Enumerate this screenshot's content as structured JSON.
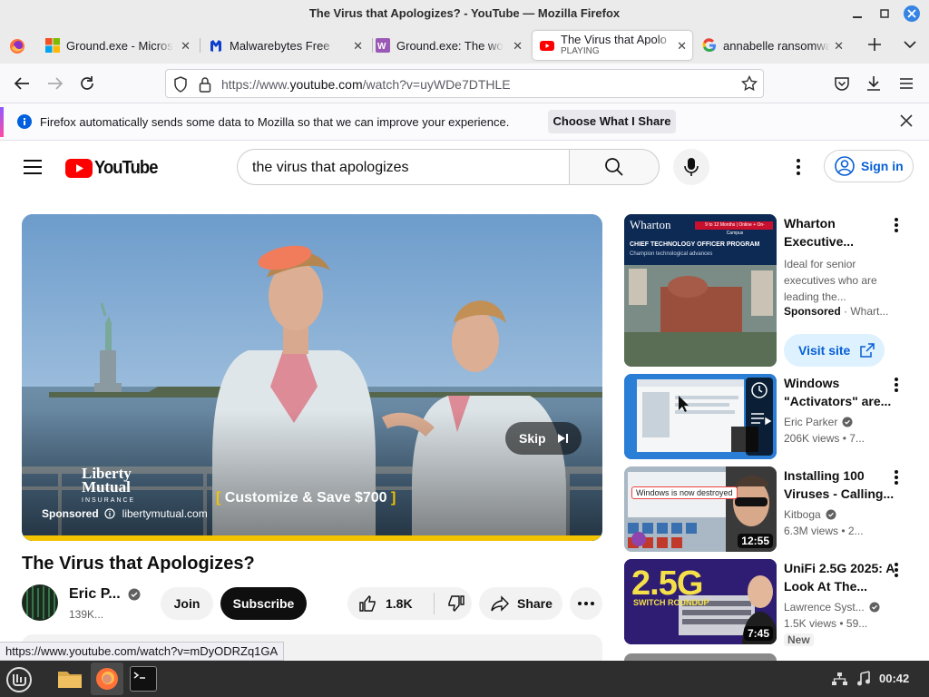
{
  "window": {
    "title": "The Virus that Apologizes? - YouTube — Mozilla Firefox"
  },
  "tabs": [
    {
      "label": "Ground.exe - Micros",
      "icon": "microsoft-logo-icon"
    },
    {
      "label": "Malwarebytes Free",
      "icon": "malwarebytes-icon"
    },
    {
      "label": "Ground.exe: The wo",
      "icon": "wiki-icon"
    },
    {
      "label": "The Virus that Apolo",
      "sub": "PLAYING",
      "icon": "youtube-icon",
      "active": true
    },
    {
      "label": "annabelle ransomwa",
      "icon": "google-icon"
    }
  ],
  "urlbar": {
    "prefix": "https://www.",
    "domain": "youtube.com",
    "path": "/watch?v=uyWDe7DTHLE"
  },
  "notification": {
    "text": "Firefox automatically sends some data to Mozilla so that we can improve your experience.",
    "button": "Choose What I Share"
  },
  "youtube": {
    "logo": "YouTube",
    "search_value": "the virus that apologizes",
    "signin": "Sign in"
  },
  "player": {
    "skip": "Skip",
    "sponsored": "Sponsored",
    "advertiser_url": "libertymutual.com",
    "ad_tagline": "Customize & Save $700",
    "brand_line1": "Liberty",
    "brand_line2": "Mutual",
    "brand_line3": "INSURANCE"
  },
  "video": {
    "title": "The Virus that Apologizes?",
    "channel": "Eric P...",
    "subscribers": "139K...",
    "join": "Join",
    "subscribe": "Subscribe",
    "likes": "1.8K",
    "share": "Share"
  },
  "sidebar": [
    {
      "title": "Wharton Executive...",
      "meta1": "Ideal for senior",
      "meta2": "executives who are",
      "meta3": "leading the...",
      "sponsored": "Sponsored",
      "sponsor_name": "· Whart...",
      "cta": "Visit site",
      "thumb_top": "9 to 12 Months | Online + On-Campus",
      "thumb_brand": "Wharton",
      "thumb_headline": "CHIEF TECHNOLOGY OFFICER PROGRAM",
      "thumb_sub": "Champion technological advances"
    },
    {
      "title": "Windows \"Activators\" are...",
      "channel": "Eric Parker",
      "meta": "206K views  • 7..."
    },
    {
      "title": "Installing 100 Viruses - Calling...",
      "channel": "Kitboga",
      "meta": "6.3M views  • 2...",
      "duration": "12:55",
      "thumb_text": "Windows is now destroyed"
    },
    {
      "title": "UniFi 2.5G 2025: A Look At The...",
      "channel": "Lawrence Syst...",
      "meta": "1.5K views  • 59...",
      "badge": "New",
      "duration": "7:45",
      "thumb_big": "2.5G",
      "thumb_sub": "SWITCH ROUNDUP"
    }
  ],
  "status_url": "https://www.youtube.com/watch?v=mDyODRZq1GA",
  "taskbar": {
    "clock": "00:42"
  }
}
